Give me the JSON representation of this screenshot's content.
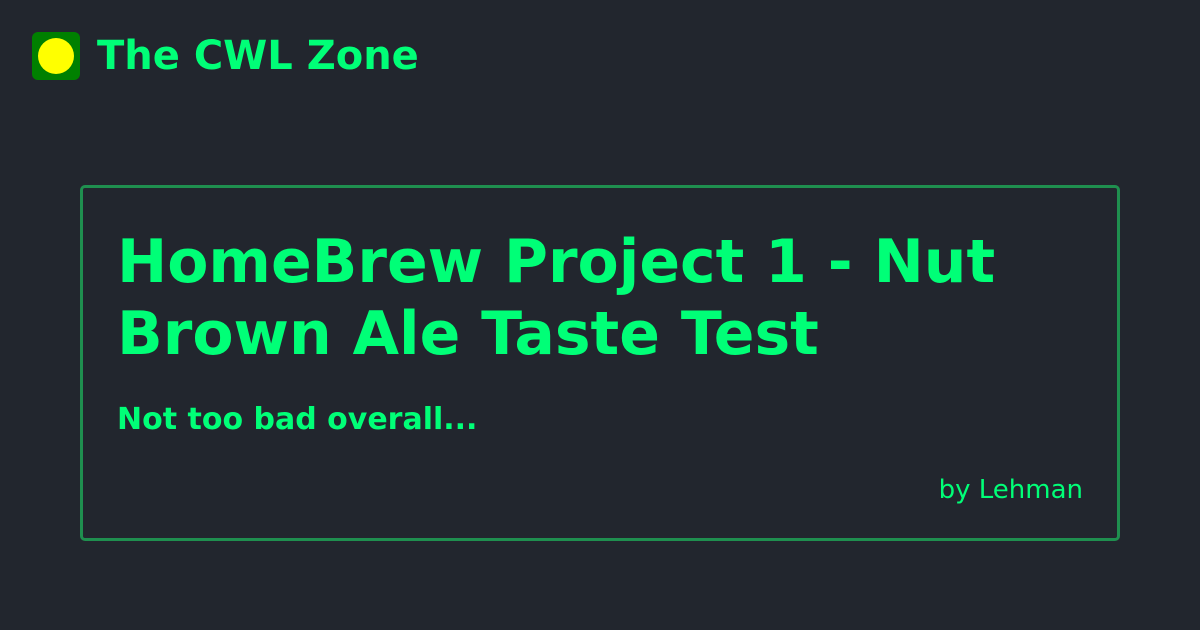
{
  "site": {
    "name": "The CWL Zone",
    "logo_icon": "yellow-circle-icon",
    "logo_bg_color": "#008000",
    "logo_dot_color": "#ffff00"
  },
  "post": {
    "title": "HomeBrew Project 1 - Nut Brown Ale Taste Test",
    "subtitle": "Not too bad overall...",
    "byline": "by Lehman"
  },
  "colors": {
    "background": "#22262e",
    "accent": "#00ff77",
    "card_border": "#1f8f4f"
  }
}
